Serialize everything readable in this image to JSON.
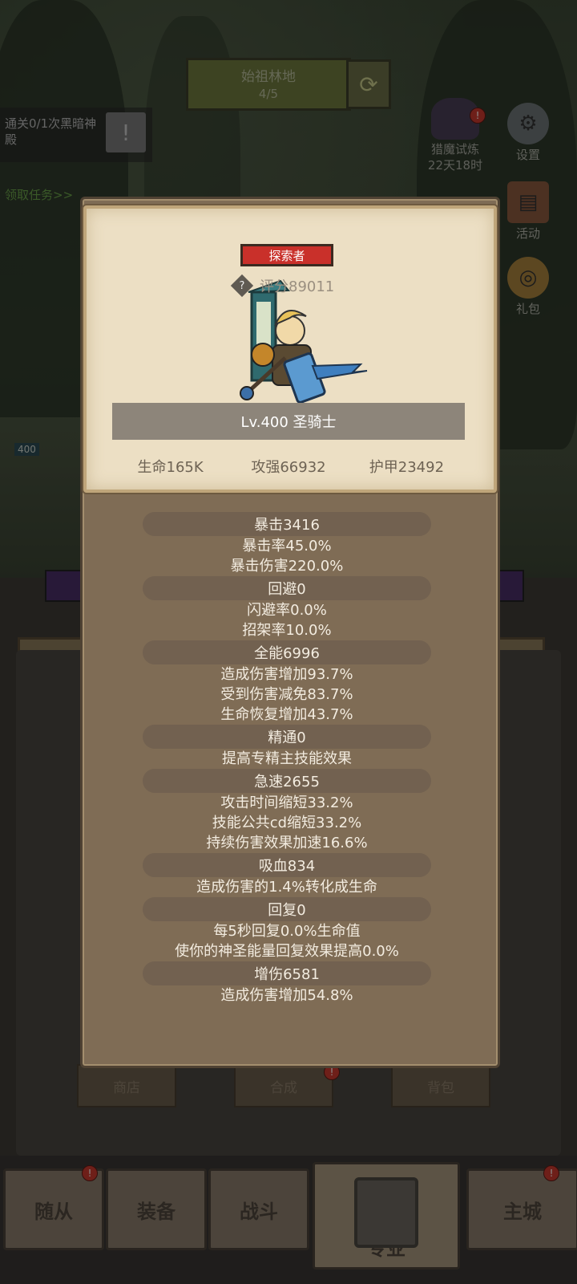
{
  "background": {
    "area_name": "始祖林地",
    "area_progress": "4/5",
    "quest_text": "通关0/1次黑暗神殿",
    "quest_link": "领取任务>>",
    "trial_label": "猎魔试炼",
    "trial_timer": "22天18时",
    "side_buttons": [
      "设置",
      "活动",
      "礼包"
    ],
    "player_level": "400",
    "shortcut_buttons": [
      "商店",
      "合成",
      "背包"
    ]
  },
  "bottom_nav": [
    "随从",
    "装备",
    "战斗",
    "专业",
    "主城"
  ],
  "hero_card": {
    "role_tag": "探索者",
    "score": "评分89011",
    "help_glyph": "?",
    "name_level": "Lv.400 圣骑士",
    "hp": "生命165K",
    "attack": "攻强66932",
    "armor": "护甲23492"
  },
  "stats": [
    {
      "head": "暴击3416",
      "lines": [
        "暴击率45.0%",
        "暴击伤害220.0%"
      ]
    },
    {
      "head": "回避0",
      "lines": [
        "闪避率0.0%",
        "招架率10.0%"
      ]
    },
    {
      "head": "全能6996",
      "lines": [
        "造成伤害增加93.7%",
        "受到伤害减免83.7%",
        "生命恢复增加43.7%"
      ]
    },
    {
      "head": "精通0",
      "lines": [
        "提高专精主技能效果"
      ]
    },
    {
      "head": "急速2655",
      "lines": [
        "攻击时间缩短33.2%",
        "技能公共cd缩短33.2%",
        "持续伤害效果加速16.6%"
      ]
    },
    {
      "head": "吸血834",
      "lines": [
        "造成伤害的1.4%转化成生命"
      ]
    },
    {
      "head": "回复0",
      "lines": [
        "每5秒回复0.0%生命值",
        "使你的神圣能量回复效果提高0.0%"
      ]
    },
    {
      "head": "增伤6581",
      "lines": [
        "造成伤害增加54.8%"
      ]
    }
  ],
  "colors": {
    "role_tag": "#c9302a",
    "modal_bg": "#7f6c55",
    "card_bg": "#ecdfc4",
    "stat_head_bg": "#726150",
    "badge": "#c83a2e"
  }
}
